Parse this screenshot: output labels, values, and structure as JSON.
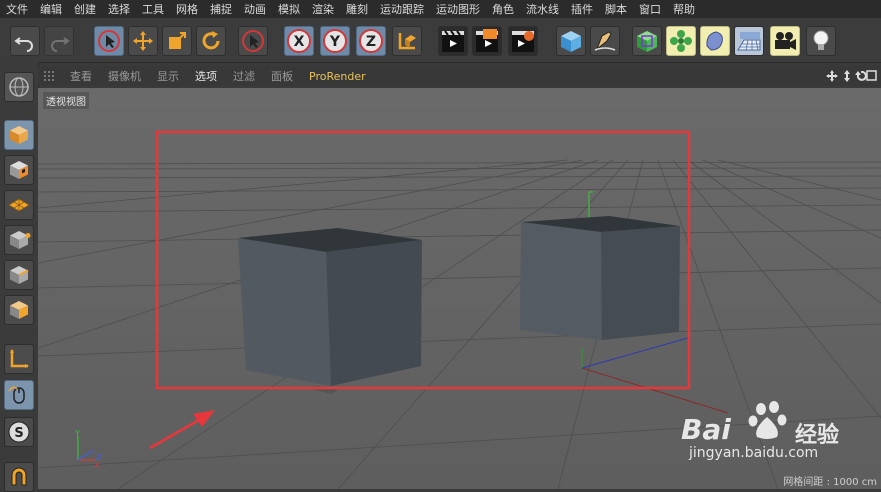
{
  "menubar": {
    "items": [
      "文件",
      "编辑",
      "创建",
      "选择",
      "工具",
      "网格",
      "捕捉",
      "动画",
      "模拟",
      "渲染",
      "雕刻",
      "运动跟踪",
      "运动图形",
      "角色",
      "流水线",
      "插件",
      "脚本",
      "窗口",
      "帮助"
    ]
  },
  "toolbar": {
    "icons": [
      "undo-icon",
      "redo-icon",
      "live-select-icon",
      "move-icon",
      "scale-icon",
      "rotate-icon",
      "select-icon",
      "x-axis-icon",
      "y-axis-icon",
      "z-axis-icon",
      "coordinate-system-icon",
      "render-view-icon",
      "render-to-picture-viewer-icon",
      "render-settings-icon",
      "cube-icon",
      "pen-icon",
      "subdivision-icon",
      "cloner-icon",
      "deformer-icon",
      "floor-icon",
      "camera-icon",
      "light-icon"
    ],
    "axis_x": "X",
    "axis_y": "Y",
    "axis_z": "Z"
  },
  "viewport_menu": {
    "items": [
      "查看",
      "摄像机",
      "显示",
      "选项",
      "过滤",
      "面板",
      "ProRender"
    ],
    "active": "选项"
  },
  "viewport": {
    "label": "透视视图",
    "grid_info": "网格间距 : 1000 cm",
    "axis_y": "Y",
    "axis_z": "Z",
    "axis_x": "X"
  },
  "watermark": {
    "brand_text": "Bai",
    "brand_text2": "经验",
    "url": "jingyan.baidu.com"
  },
  "colors": {
    "annotation_red": "#e8373a",
    "pro_render": "#e9c45a",
    "selected_blue": "#7d94ad"
  }
}
